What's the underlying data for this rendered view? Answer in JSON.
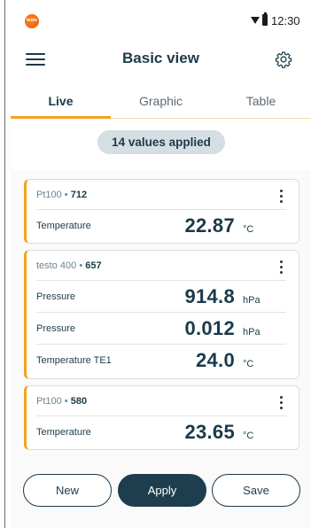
{
  "status_bar": {
    "logo_text": "testo",
    "time": "12:30"
  },
  "header": {
    "title": "Basic view"
  },
  "tabs": [
    {
      "label": "Live",
      "active": true
    },
    {
      "label": "Graphic",
      "active": false
    },
    {
      "label": "Table",
      "active": false
    }
  ],
  "info": {
    "applied_text": "14 values applied"
  },
  "cards": [
    {
      "probe_name": "Pt100",
      "probe_id": "712",
      "rows": [
        {
          "label": "Temperature",
          "value": "22.87",
          "unit": "°C"
        }
      ]
    },
    {
      "probe_name": "testo 400",
      "probe_id": "657",
      "rows": [
        {
          "label": "Pressure",
          "value": "914.8",
          "unit": "hPa"
        },
        {
          "label": "Pressure",
          "value": "0.012",
          "unit": "hPa"
        },
        {
          "label": "Temperature TE1",
          "value": "24.0",
          "unit": "°C"
        }
      ]
    },
    {
      "probe_name": "Pt100",
      "probe_id": "580",
      "rows": [
        {
          "label": "Temperature",
          "value": "23.65",
          "unit": "°C"
        }
      ]
    }
  ],
  "buttons": {
    "new_label": "New",
    "apply_label": "Apply",
    "save_label": "Save"
  },
  "colors": {
    "accent": "#f5a21c",
    "primary": "#1e3d4f",
    "pill_bg": "#d5dee3"
  }
}
